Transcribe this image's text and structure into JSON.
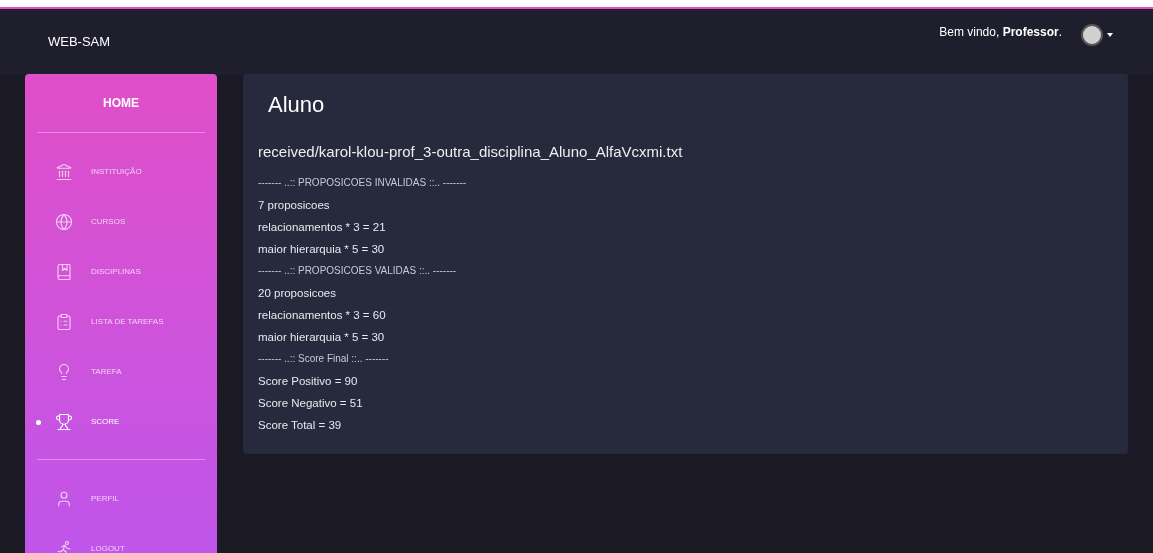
{
  "header": {
    "brand": "WEB-SAM",
    "greeting": "Bem vindo, **Professor**."
  },
  "sidebar": {
    "home": "HOME",
    "sections": [
      {
        "items": [
          {
            "label": "INSTITUIÇÃO",
            "selected": false
          },
          {
            "label": "CURSOS",
            "selected": false
          },
          {
            "label": "DISCIPLINAS",
            "selected": false
          },
          {
            "label": "LISTA DE TAREFAS",
            "selected": false
          },
          {
            "label": "TAREFA",
            "selected": false
          },
          {
            "label": "SCORE",
            "selected": true
          }
        ]
      },
      {
        "items": [
          {
            "label": "PERFIL",
            "selected": false
          },
          {
            "label": "LOGOUT",
            "selected": false
          }
        ]
      }
    ]
  },
  "content": {
    "title": "Aluno",
    "file": "received/karol-klou-prof_3-outra_disciplina_Aluno_AlfaVcxmi.txt",
    "lines": [
      {
        "kind": "separator",
        "text": "------- ..:: PROPOSICOES INVALIDAS ::.. -------"
      },
      {
        "kind": "value",
        "text": "7 proposicoes"
      },
      {
        "kind": "value",
        "text": "relacionamentos * 3 = 21"
      },
      {
        "kind": "value",
        "text": "maior hierarquia * 5 = 30"
      },
      {
        "kind": "separator",
        "text": "------- ..:: PROPOSICOES VALIDAS ::.. -------"
      },
      {
        "kind": "value",
        "text": "20 proposicoes"
      },
      {
        "kind": "value",
        "text": "relacionamentos * 3 = 60"
      },
      {
        "kind": "value",
        "text": "maior hierarquia * 5 = 30"
      },
      {
        "kind": "separator",
        "text": "------- ..:: Score Final ::.. -------"
      },
      {
        "kind": "value",
        "text": "Score Positivo = 90"
      },
      {
        "kind": "value",
        "text": "Score Negativo = 51"
      },
      {
        "kind": "value",
        "text": "Score Total = 39"
      }
    ]
  }
}
